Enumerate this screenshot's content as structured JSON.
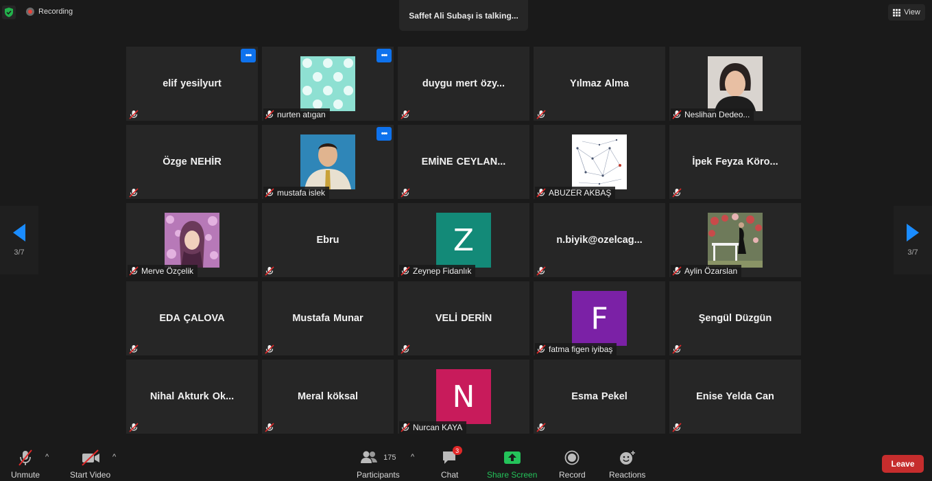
{
  "top": {
    "recording_label": "Recording",
    "talking_text": "Saffet Ali Subaşı is talking...",
    "view_label": "View"
  },
  "pagination": {
    "left": "3/7",
    "right": "3/7"
  },
  "tiles": [
    {
      "display": "elif yesilyurt",
      "more": true
    },
    {
      "label": "nurten atıgan",
      "pic": "polka-dot",
      "more": true
    },
    {
      "display": "duygu  mert  özy..."
    },
    {
      "display": "Yılmaz Alma"
    },
    {
      "label": "Neslihan Dedeo...",
      "pic": "woman-portrait"
    },
    {
      "display": "Özge NEHİR"
    },
    {
      "label": "mustafa islek",
      "pic": "man-portrait",
      "more": true
    },
    {
      "display": "EMİNE  CEYLAN..."
    },
    {
      "label": "ABUZER AKBAŞ",
      "pic": "diagram"
    },
    {
      "display": "İpek  Feyza  Köro..."
    },
    {
      "label": "Merve Özçelik",
      "pic": "flowers-portrait"
    },
    {
      "display": "Ebru"
    },
    {
      "label": "Zeynep Fidanlık",
      "letter": "Z",
      "letter_color": "#138a78"
    },
    {
      "display": "n.biyik@ozelcag..."
    },
    {
      "label": "Aylin Özarslan",
      "pic": "garden-photo"
    },
    {
      "display": "EDA ÇALOVA"
    },
    {
      "display": "Mustafa Munar"
    },
    {
      "display": "VELİ DERİN"
    },
    {
      "label": "fatma figen iyibaş",
      "letter": "F",
      "letter_color": "#7b21a6"
    },
    {
      "display": "Şengül Düzgün"
    },
    {
      "display": "Nihal  Akturk  Ok..."
    },
    {
      "display": "Meral köksal"
    },
    {
      "label": "Nurcan KAYA",
      "letter": "N",
      "letter_color": "#c81b5b"
    },
    {
      "display": "Esma Pekel"
    },
    {
      "display": "Enise Yelda Can"
    }
  ],
  "toolbar": {
    "unmute": "Unmute",
    "start_video": "Start Video",
    "participants": "Participants",
    "participants_count": "175",
    "chat": "Chat",
    "chat_badge": "3",
    "share_screen": "Share Screen",
    "record": "Record",
    "reactions": "Reactions",
    "leave": "Leave"
  }
}
